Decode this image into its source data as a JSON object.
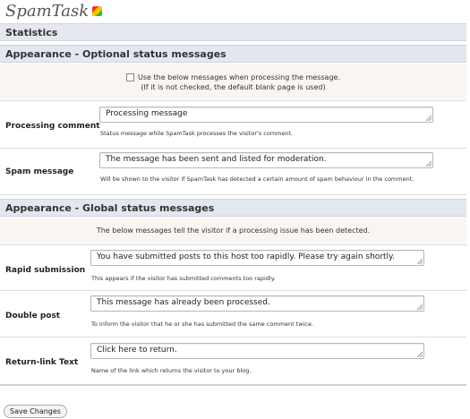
{
  "app": {
    "title": "SpamTask"
  },
  "sections": {
    "statistics": "Statistics",
    "optional": "Appearance - Optional status messages",
    "global": "Appearance - Global status messages"
  },
  "optional": {
    "checkbox_label": "Use the below messages when processing the message.",
    "checkbox_note": "(If it is not checked, the default blank page is used)",
    "checkbox_checked": false,
    "processing": {
      "label": "Processing comment",
      "value": "Processing message",
      "help": "Status message while SpamTask processes the visitor's comment."
    },
    "spam": {
      "label": "Spam message",
      "value": "The message has been sent and listed for moderation.",
      "help": "Will be shown to the visitor if SpamTask has detected a certain amount of spam behaviour in the comment."
    }
  },
  "global": {
    "intro": "The below messages tell the visitor if a processing issue has been detected.",
    "rapid": {
      "label": "Rapid submission",
      "value": "You have submitted posts to this host too rapidly. Please try again shortly.",
      "help": "This appears if the visitor has submitted comments too rapidly."
    },
    "double": {
      "label": "Double post",
      "value": "This message has already been processed.",
      "help": "To inform the visitor that he or she has submitted the same comment twice."
    },
    "returnlink": {
      "label": "Return-link Text",
      "value": "Click here to return.",
      "help": "Name of the link which returns the visitor to your blog."
    }
  },
  "actions": {
    "save": "Save Changes"
  },
  "colors": {
    "section_bg": "#e5e8ef",
    "panel_bg": "#f9f6f2",
    "border": "#b7b7b7"
  }
}
